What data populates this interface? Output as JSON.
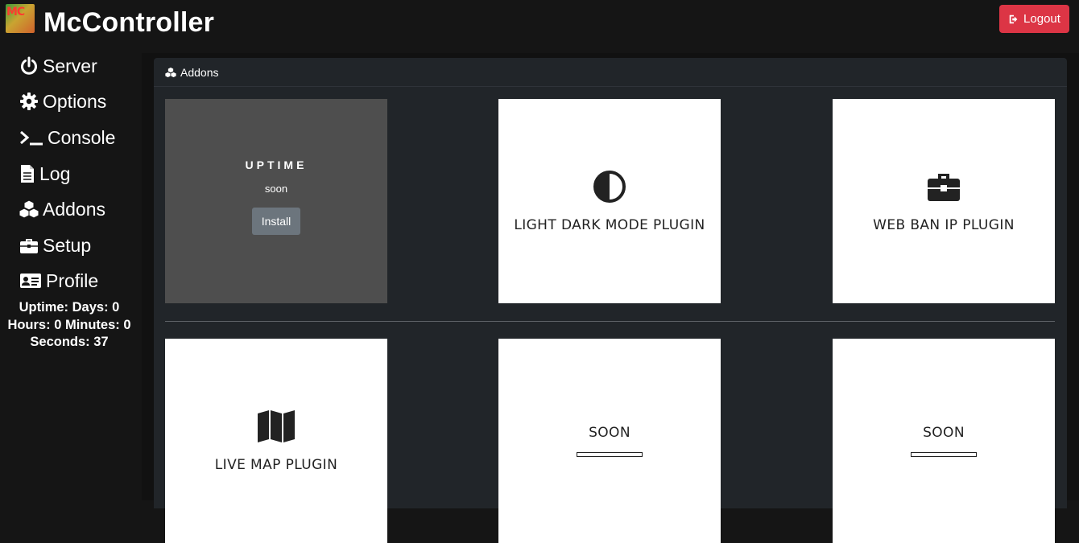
{
  "app": {
    "title": "McController",
    "logo_text": "MC"
  },
  "header": {
    "logout_label": "Logout"
  },
  "sidebar": {
    "items": [
      {
        "label": "Server",
        "icon": "power-icon"
      },
      {
        "label": "Options",
        "icon": "gear-icon"
      },
      {
        "label": "Console",
        "icon": "terminal-icon"
      },
      {
        "label": "Log",
        "icon": "file-icon"
      },
      {
        "label": "Addons",
        "icon": "cubes-icon"
      },
      {
        "label": "Setup",
        "icon": "toolbox-icon"
      },
      {
        "label": "Profile",
        "icon": "id-card-icon"
      }
    ],
    "uptime_lines": [
      "Uptime: Days: 0",
      "Hours: 0 Minutes: 0",
      "Seconds: 37"
    ]
  },
  "card": {
    "title": "Addons"
  },
  "addons": [
    {
      "title": "UPTIME",
      "subtitle": "soon",
      "button": "Install",
      "style": "dark"
    },
    {
      "title": "LIGHT DARK MODE PLUGIN",
      "icon": "half-circle-icon"
    },
    {
      "title": "WEB BAN IP PLUGIN",
      "icon": "toolbox-icon"
    },
    {
      "title": "LIVE MAP PLUGIN",
      "icon": "map-icon"
    },
    {
      "title": "SOON",
      "icon": "placeholder-bar"
    },
    {
      "title": "SOON",
      "icon": "placeholder-bar"
    }
  ],
  "colors": {
    "danger": "#dc3545",
    "secondary": "#6c757d",
    "card_bg": "#212529",
    "page_bg": "#151515"
  }
}
